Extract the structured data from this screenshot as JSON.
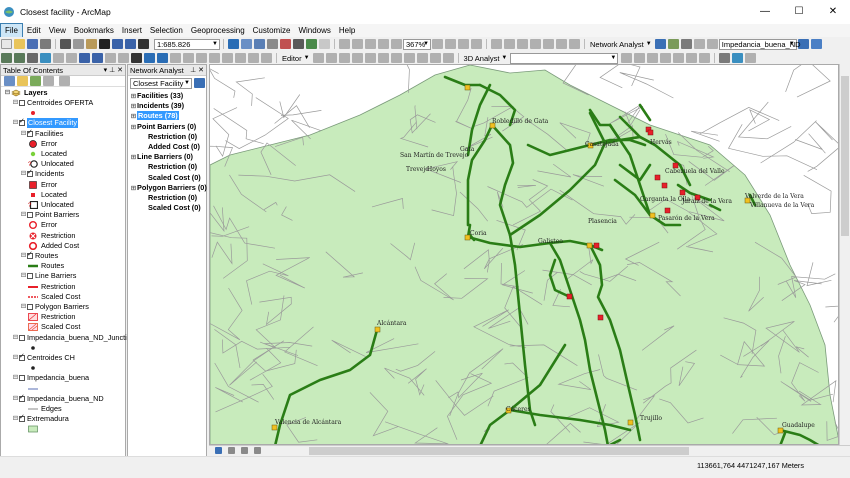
{
  "window": {
    "title": "Closest facility - ArcMap"
  },
  "menu": [
    "File",
    "Edit",
    "View",
    "Bookmarks",
    "Insert",
    "Selection",
    "Geoprocessing",
    "Customize",
    "Windows",
    "Help"
  ],
  "toolbar": {
    "scale": "1:685.826",
    "zoom": "367%",
    "network_analyst_label": "Network Analyst",
    "network_dataset": "Impedancia_buena_ND",
    "editor_label": "Editor",
    "analyst_3d_label": "3D Analyst"
  },
  "toc": {
    "title": "Table Of Contents",
    "layers_root": "Layers",
    "rows": [
      {
        "label": "Centroides OFERTA",
        "checked": false,
        "indent": 1,
        "expand": true
      },
      {
        "label": "",
        "indent": 3,
        "symbol": "red-dot"
      },
      {
        "label": "Closest Facility",
        "checked": true,
        "indent": 1,
        "expand": true,
        "selected": true
      },
      {
        "label": "Facilities",
        "checked": true,
        "indent": 2,
        "expand": true
      },
      {
        "label": "Error",
        "indent": 3,
        "symbol": "red-circle"
      },
      {
        "label": "Located",
        "indent": 3,
        "symbol": "green-dot"
      },
      {
        "label": "Unlocated",
        "indent": 3,
        "symbol": "unlocated-circle"
      },
      {
        "label": "Incidents",
        "checked": true,
        "indent": 2,
        "expand": true
      },
      {
        "label": "Error",
        "indent": 3,
        "symbol": "red-square"
      },
      {
        "label": "Located",
        "indent": 3,
        "symbol": "small-red-square"
      },
      {
        "label": "Unlocated",
        "indent": 3,
        "symbol": "unlocated-square"
      },
      {
        "label": "Point Barriers",
        "checked": false,
        "indent": 2,
        "expand": true
      },
      {
        "label": "Error",
        "indent": 3,
        "symbol": "red-circle-outline"
      },
      {
        "label": "Restriction",
        "indent": 3,
        "symbol": "restriction-x"
      },
      {
        "label": "Added Cost",
        "indent": 3,
        "symbol": "added-cost-circle"
      },
      {
        "label": "Routes",
        "checked": true,
        "indent": 2,
        "expand": true
      },
      {
        "label": "Routes",
        "indent": 3,
        "symbol": "green-line"
      },
      {
        "label": "Line Barriers",
        "checked": false,
        "indent": 2,
        "expand": true
      },
      {
        "label": "Restriction",
        "indent": 3,
        "symbol": "red-line"
      },
      {
        "label": "Scaled Cost",
        "indent": 3,
        "symbol": "scaled-line"
      },
      {
        "label": "Polygon Barriers",
        "checked": false,
        "indent": 2,
        "expand": true
      },
      {
        "label": "Restriction",
        "indent": 3,
        "symbol": "hatch-red"
      },
      {
        "label": "Scaled Cost",
        "indent": 3,
        "symbol": "hatch-orange"
      },
      {
        "label": "Impedancia_buena_ND_Junctions",
        "checked": false,
        "indent": 1,
        "expand": true
      },
      {
        "label": "",
        "indent": 3,
        "symbol": "black-dot"
      },
      {
        "label": "Centroides CH",
        "checked": true,
        "indent": 1,
        "expand": true
      },
      {
        "label": "",
        "indent": 3,
        "symbol": "black-dot"
      },
      {
        "label": "Impedancia_buena",
        "checked": false,
        "indent": 1,
        "expand": true
      },
      {
        "label": "",
        "indent": 3,
        "symbol": "blue-line"
      },
      {
        "label": "Impedancia_buena_ND",
        "checked": true,
        "indent": 1,
        "expand": true
      },
      {
        "label": "Edges",
        "indent": 3,
        "symbol": "gray-line"
      },
      {
        "label": "Extremadura",
        "checked": true,
        "indent": 1,
        "expand": true
      },
      {
        "label": "",
        "indent": 3,
        "symbol": "green-rect"
      }
    ]
  },
  "network_analyst": {
    "title": "Network Analyst",
    "analysis": "Closest Facility",
    "items": [
      {
        "label": "Facilities (33)",
        "indent": 0,
        "expand": true
      },
      {
        "label": "Incidents (39)",
        "indent": 0,
        "expand": true
      },
      {
        "label": "Routes (78)",
        "indent": 0,
        "expand": true,
        "selected": true
      },
      {
        "label": "Point Barriers (0)",
        "indent": 0,
        "expand": true
      },
      {
        "label": "Restriction (0)",
        "indent": 1
      },
      {
        "label": "Added Cost (0)",
        "indent": 1
      },
      {
        "label": "Line Barriers (0)",
        "indent": 0,
        "expand": true
      },
      {
        "label": "Restriction (0)",
        "indent": 1
      },
      {
        "label": "Scaled Cost (0)",
        "indent": 1
      },
      {
        "label": "Polygon Barriers (0)",
        "indent": 0,
        "expand": true
      },
      {
        "label": "Restriction (0)",
        "indent": 1
      },
      {
        "label": "Scaled Cost (0)",
        "indent": 1
      }
    ]
  },
  "map": {
    "labels": [
      "Robledillo de Gata",
      "Gata",
      "San Martín de Trevejo",
      "Trevejo",
      "Hoyos",
      "Casatejada",
      "Hervás",
      "Cabezuela del Valle",
      "Garganta la Olla",
      "Jaraíz de la Vera",
      "Valverde de la Vera",
      "Villanueva de la Vera",
      "Pasarón de la Vera",
      "Plasencia",
      "Coria",
      "Galisteo",
      "Alcántara",
      "Valencia de Alcántara",
      "Cáceres",
      "Trujillo",
      "Guadalupe"
    ]
  },
  "status": {
    "coords": "113661,764  4471247,167 Meters"
  },
  "colors": {
    "land": "#c8ebbc",
    "route": "#2a7d16",
    "road": "#9a9a9a",
    "facility": "#f0c020",
    "incident": "#e8202a"
  }
}
